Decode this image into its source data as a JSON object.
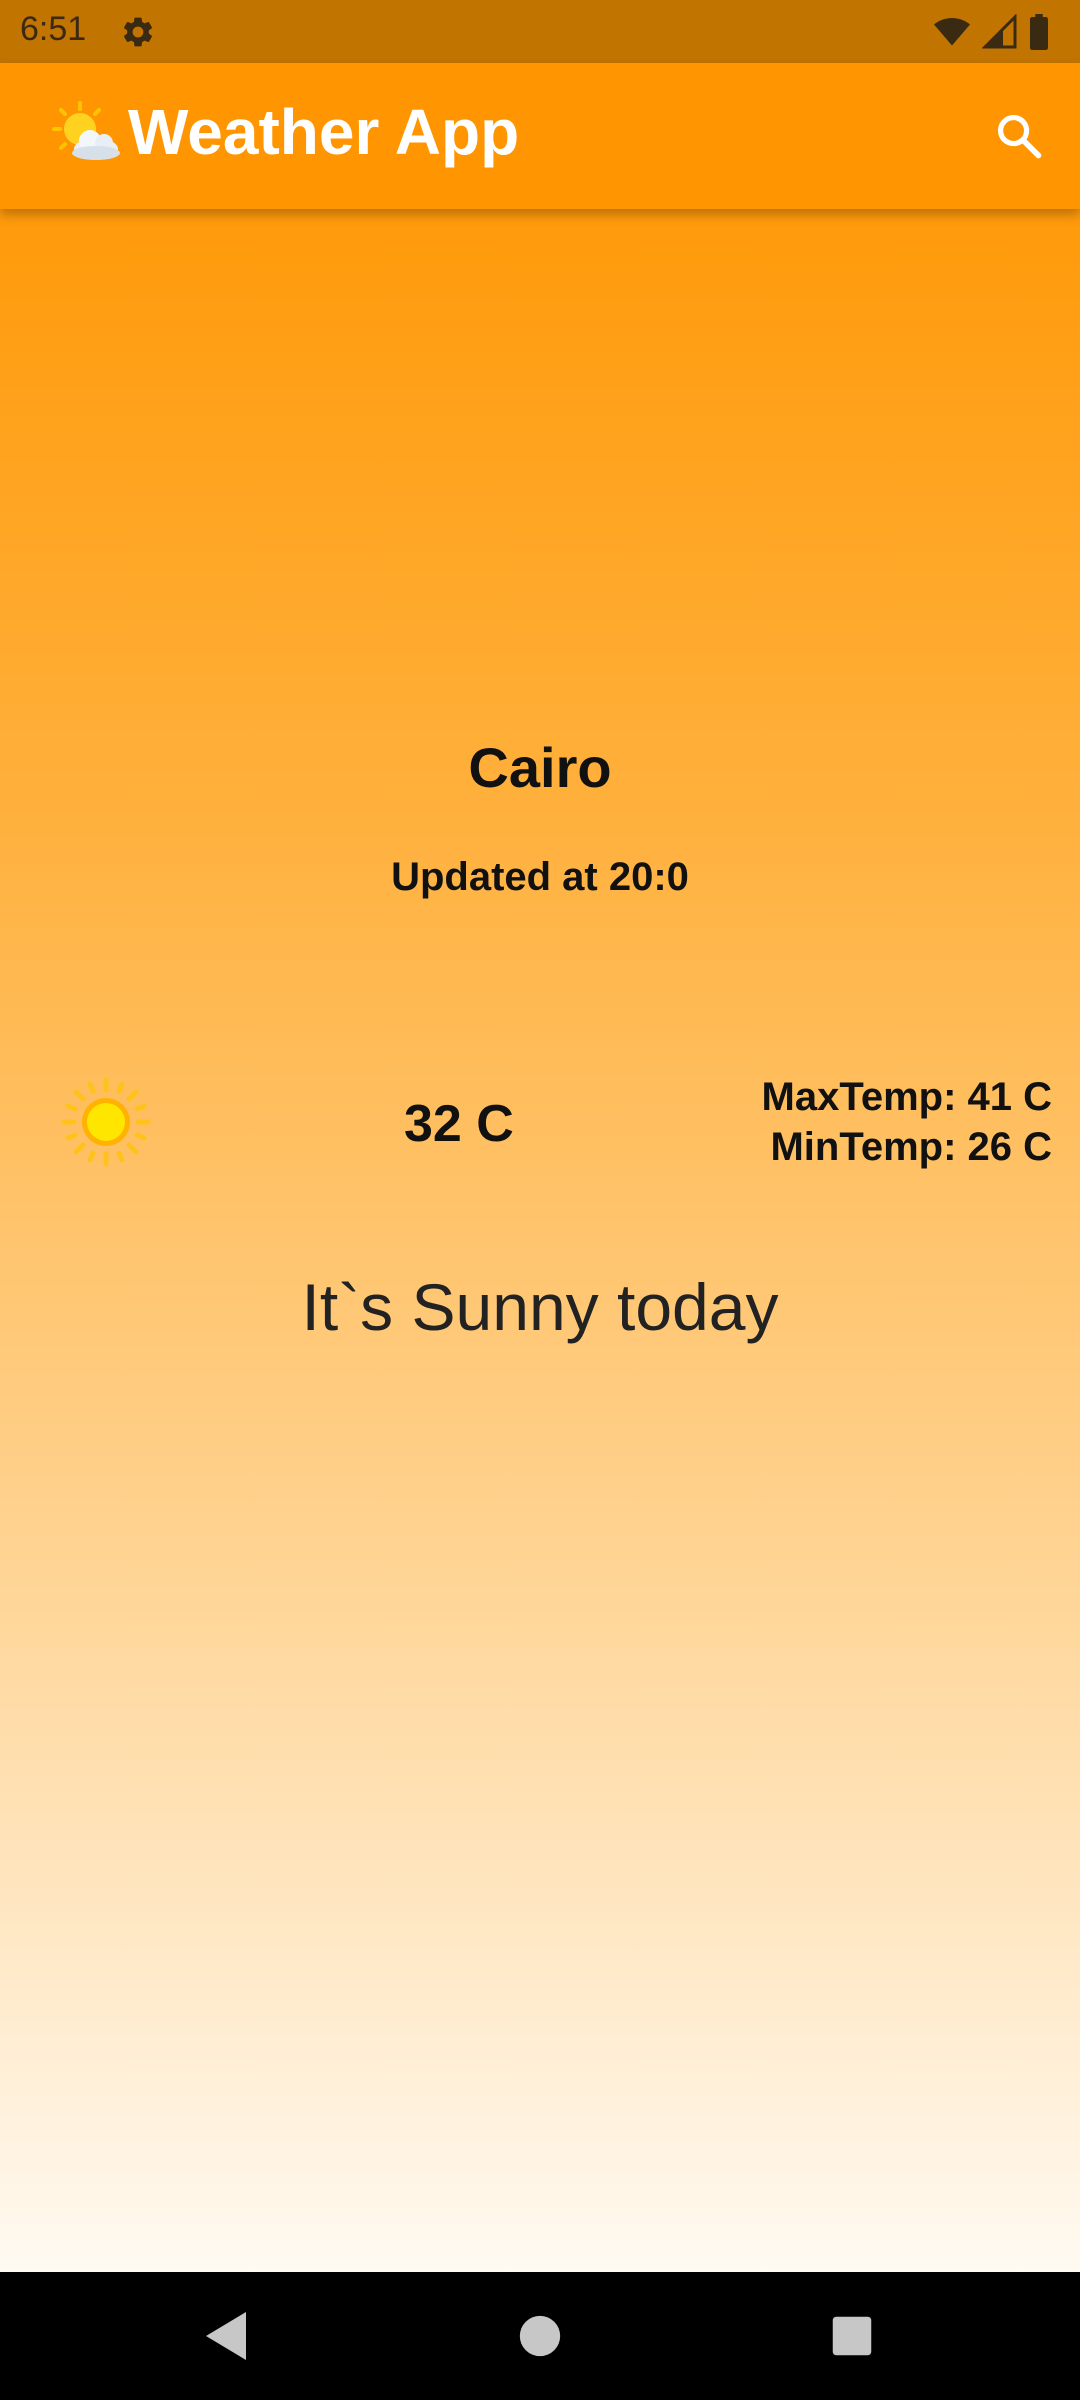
{
  "status_bar": {
    "time": "6:51",
    "icons": [
      "settings-icon",
      "wifi-icon",
      "signal-icon",
      "battery-icon"
    ]
  },
  "app_bar": {
    "title": "Weather App",
    "logo_icon": "sun-cloud-icon",
    "search_icon": "search-icon"
  },
  "weather": {
    "city": "Cairo",
    "updated": "Updated at 20:0",
    "condition_icon": "sun-icon",
    "temperature": "32 C",
    "max_temp": "MaxTemp: 41 C",
    "min_temp": "MinTemp: 26 C",
    "description": "It`s Sunny today"
  },
  "nav_bar": {
    "buttons": [
      "back-icon",
      "home-icon",
      "recents-icon"
    ]
  },
  "colors": {
    "status_bar": "#C27400",
    "app_bar": "#FF9500",
    "gradient_top": "#FF9A0A",
    "gradient_bottom": "#FFFAF2"
  }
}
